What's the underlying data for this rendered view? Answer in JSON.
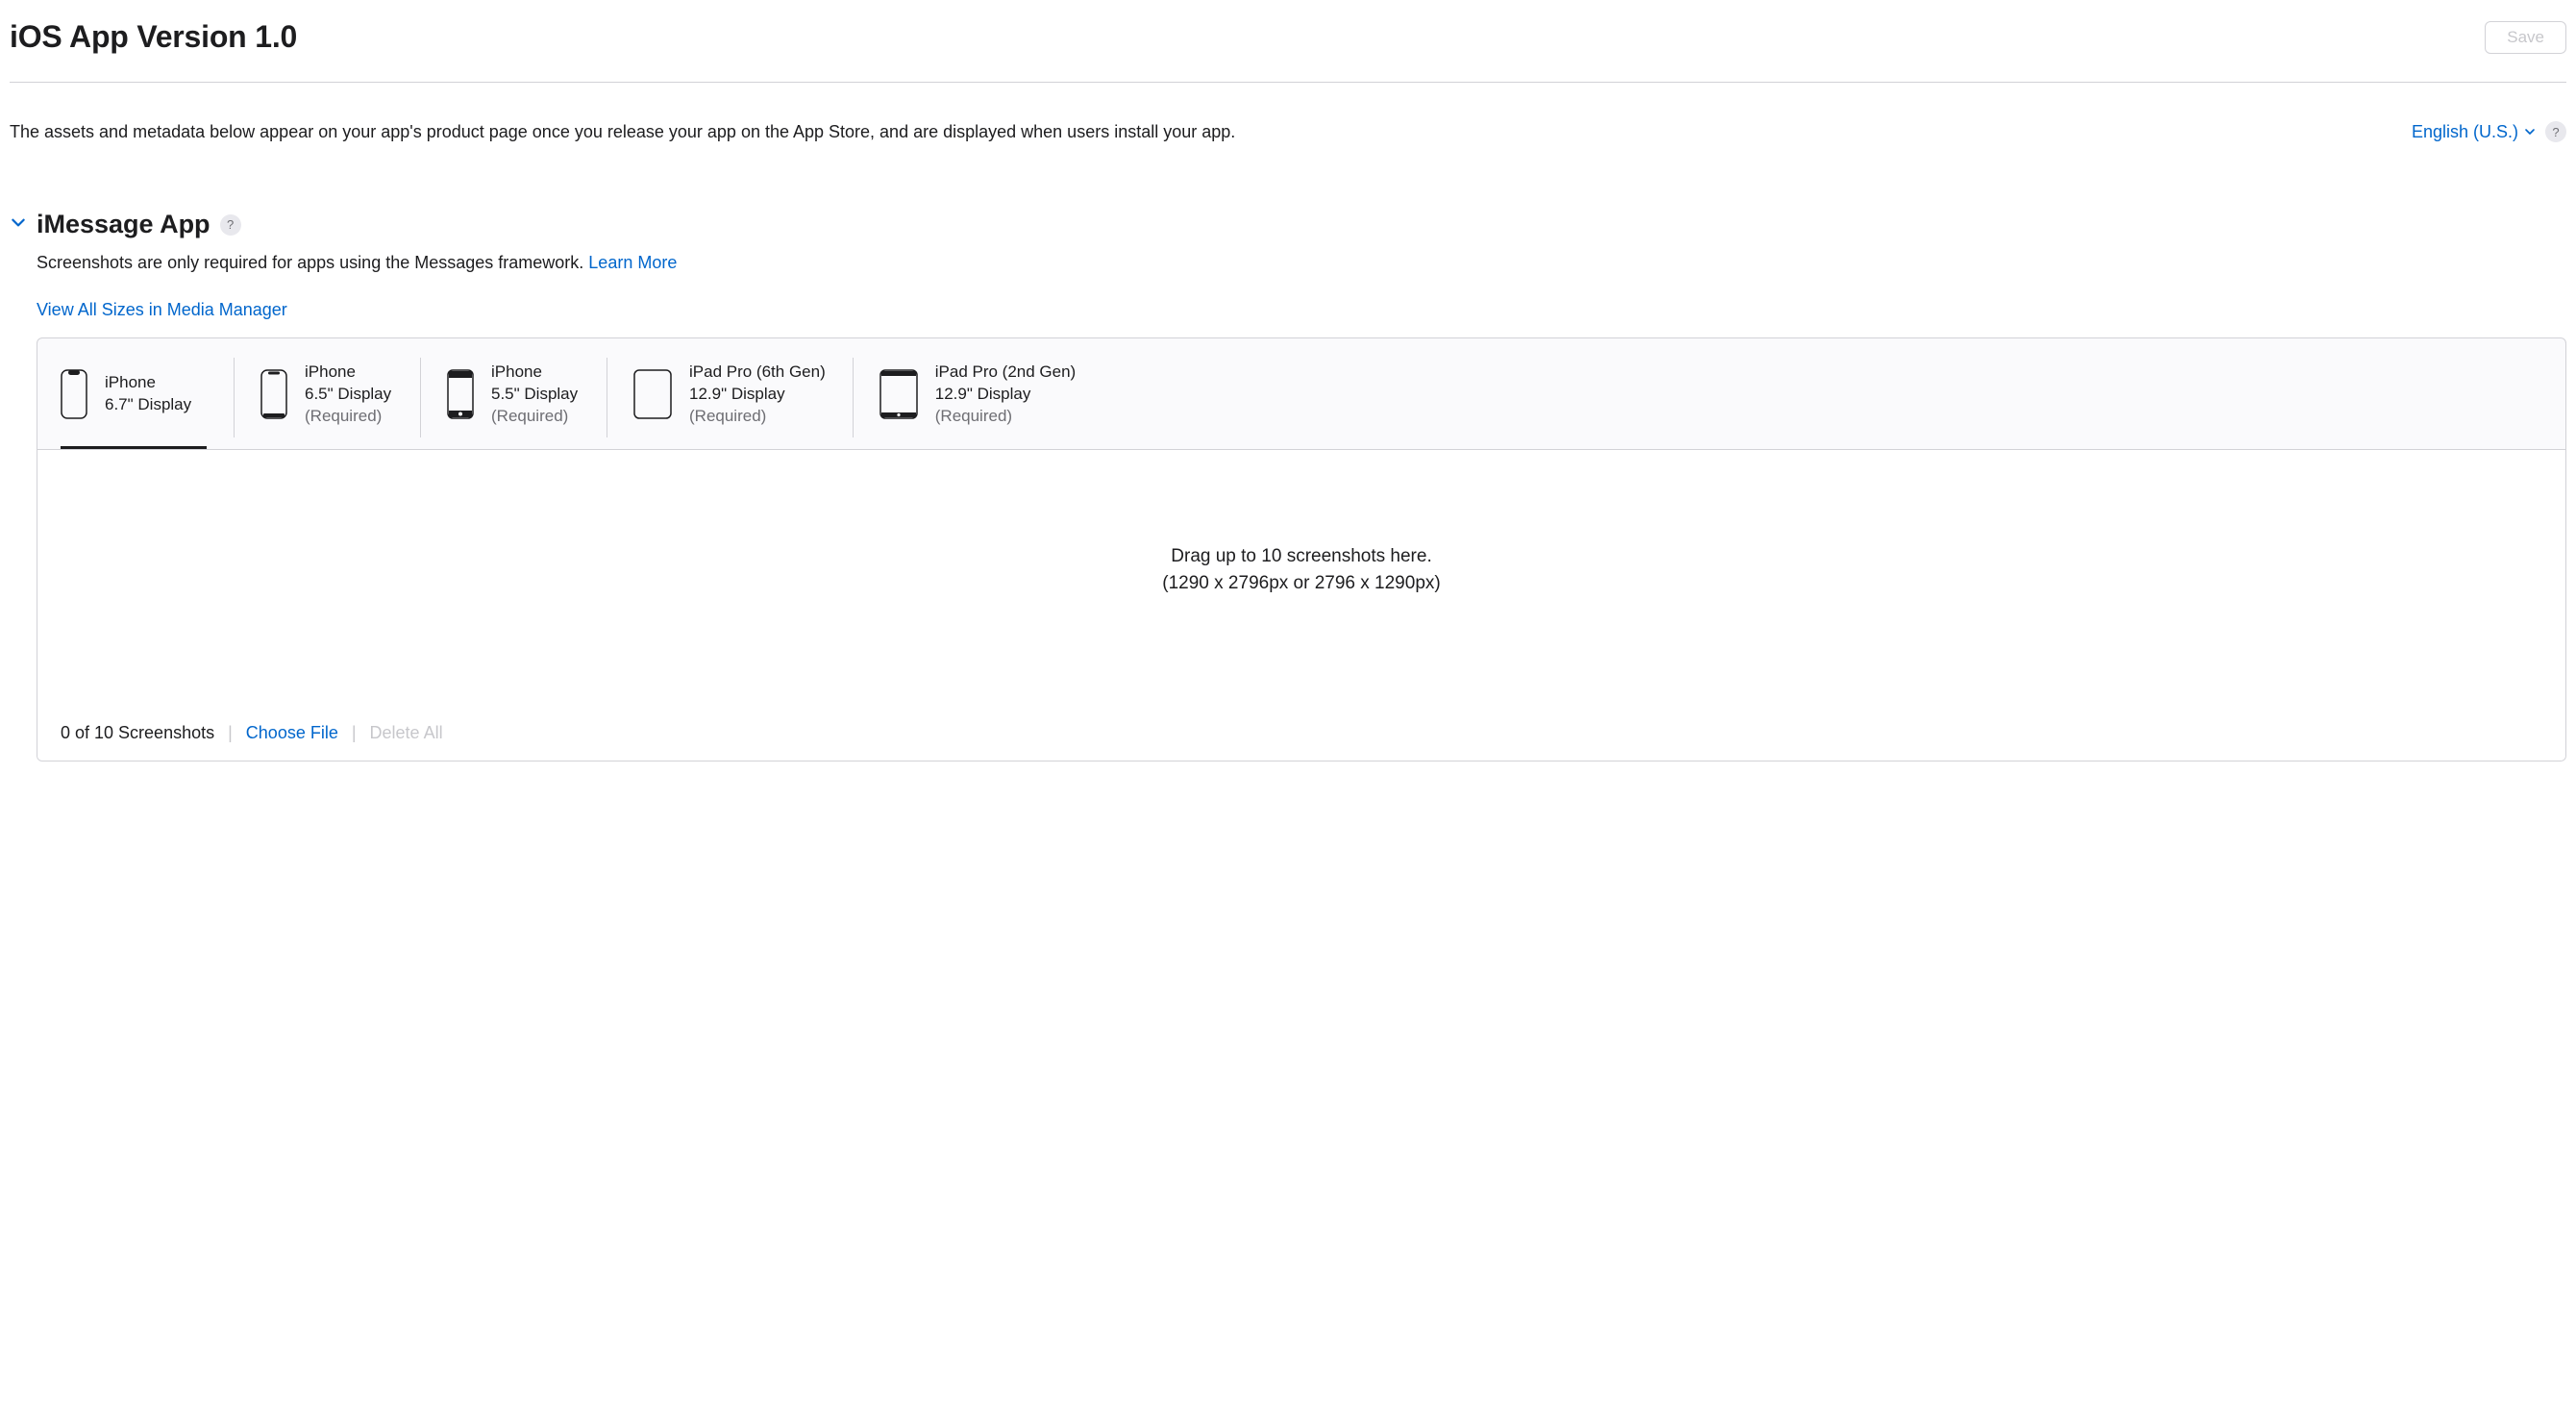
{
  "header": {
    "title": "iOS App Version 1.0",
    "save_label": "Save"
  },
  "desc": {
    "text": "The assets and metadata below appear on your app's product page once you release your app on the App Store, and are displayed when users install your app.",
    "language": "English (U.S.)",
    "help": "?"
  },
  "section": {
    "title": "iMessage App",
    "help": "?",
    "sub_text": "Screenshots are only required for apps using the Messages framework. ",
    "learn_more": "Learn More",
    "media_link": "View All Sizes in Media Manager"
  },
  "tabs": [
    {
      "line1": "iPhone",
      "line2": "6.7\" Display",
      "line3": ""
    },
    {
      "line1": "iPhone",
      "line2": "6.5\" Display",
      "line3": "(Required)"
    },
    {
      "line1": "iPhone",
      "line2": "5.5\" Display",
      "line3": "(Required)"
    },
    {
      "line1": "iPad Pro (6th Gen)",
      "line2": "12.9\" Display",
      "line3": "(Required)"
    },
    {
      "line1": "iPad Pro (2nd Gen)",
      "line2": "12.9\" Display",
      "line3": "(Required)"
    }
  ],
  "dropzone": {
    "line1": "Drag up to 10 screenshots here.",
    "line2": "(1290 x 2796px or 2796 x 1290px)"
  },
  "footer": {
    "count": "0 of 10 Screenshots",
    "choose": "Choose File",
    "delete": "Delete All"
  }
}
